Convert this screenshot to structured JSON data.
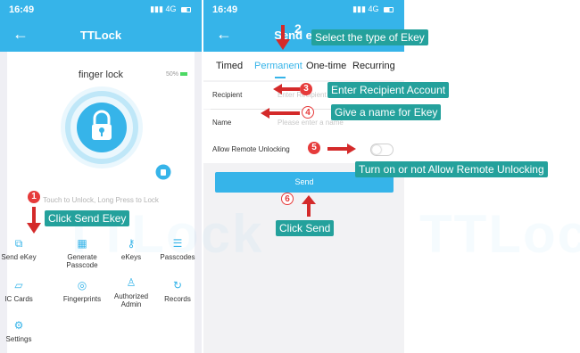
{
  "left_screen": {
    "status": {
      "time": "16:49",
      "network": "4G"
    },
    "nav": {
      "back": "←",
      "title": "TTLock"
    },
    "lock_name": "finger lock",
    "battery": "50%",
    "hint": "Touch to Unlock, Long Press to Lock",
    "grid": [
      {
        "label": "Send eKey",
        "icon": "send-ekey-icon",
        "glyph": "⧉"
      },
      {
        "label": "Generate Passcode",
        "icon": "keypad-icon",
        "glyph": "▦"
      },
      {
        "label": "eKeys",
        "icon": "keys-icon",
        "glyph": "⚷"
      },
      {
        "label": "Passcodes",
        "icon": "list-icon",
        "glyph": "☰"
      },
      {
        "label": "IC Cards",
        "icon": "card-icon",
        "glyph": "▱"
      },
      {
        "label": "Fingerprints",
        "icon": "fingerprint-icon",
        "glyph": "◎"
      },
      {
        "label": "Authorized Admin",
        "icon": "admin-icon",
        "glyph": "♙"
      },
      {
        "label": "Records",
        "icon": "records-icon",
        "glyph": "↻"
      },
      {
        "label": "Settings",
        "icon": "settings-icon",
        "glyph": "⚙"
      }
    ]
  },
  "right_screen": {
    "status": {
      "time": "16:49",
      "network": "4G"
    },
    "nav": {
      "back": "←",
      "title": "Send eKey"
    },
    "tabs": [
      "Timed",
      "Permanent",
      "One-time",
      "Recurring"
    ],
    "active_tab": "Permanent",
    "recipient_label": "Recipient",
    "recipient_placeholder": "Enter Recipient Account",
    "name_label": "Name",
    "name_placeholder": "Please enter a name",
    "remote_label": "Allow Remote Unlocking",
    "remote_enabled": false,
    "send_button": "Send"
  },
  "annotations": {
    "step1": "1",
    "step1_text": "Click Send Ekey",
    "step2": "2",
    "step2_text": "Select the type of Ekey",
    "step3": "3",
    "step3_text": "Enter Recipient Account",
    "step4": "4",
    "step4_text": "Give a name for Ekey",
    "step5": "5",
    "step5_text": "Turn on or not Allow Remote Unlocking",
    "step6": "6",
    "step6_text": "Click Send"
  },
  "colors": {
    "primary": "#36b4e9",
    "annotation_bg": "#24a19c",
    "arrow": "#d42a2a"
  }
}
